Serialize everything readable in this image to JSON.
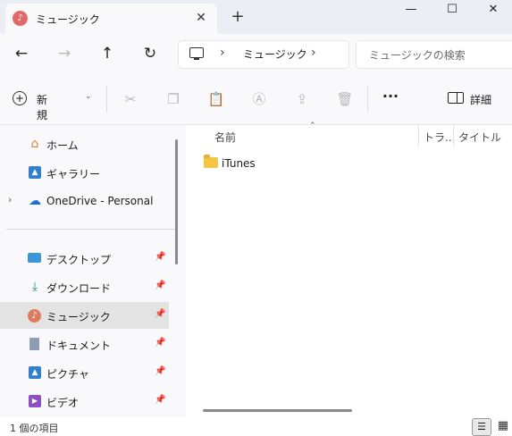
{
  "tab": {
    "title": "ミュージック",
    "icon": "music-note-icon",
    "close": "✕"
  },
  "new_tab": "+",
  "window": {
    "minimize": "—",
    "maximize": "☐",
    "close": "✕"
  },
  "nav": {
    "back": "←",
    "forward": "→",
    "up": "↑",
    "refresh": "↻"
  },
  "address": {
    "separator1": "›",
    "segment": "ミュージック",
    "separator2": "›"
  },
  "search": {
    "placeholder": "ミュージックの検索"
  },
  "toolbar": {
    "new_label": "新規作成",
    "new_caret": "⌄",
    "more": "···",
    "details_label": "詳細"
  },
  "sidebar": {
    "items": [
      {
        "label": "ホーム",
        "icon": "home-icon"
      },
      {
        "label": "ギャラリー",
        "icon": "gallery-icon"
      },
      {
        "label": "OneDrive - Personal",
        "icon": "onedrive-icon"
      },
      {
        "label": "デスクトップ",
        "icon": "desktop-icon",
        "pinned": true
      },
      {
        "label": "ダウンロード",
        "icon": "download-icon",
        "pinned": true
      },
      {
        "label": "ミュージック",
        "icon": "music-icon",
        "pinned": true,
        "selected": true
      },
      {
        "label": "ドキュメント",
        "icon": "documents-icon",
        "pinned": true
      },
      {
        "label": "ピクチャ",
        "icon": "pictures-icon",
        "pinned": true
      },
      {
        "label": "ビデオ",
        "icon": "videos-icon",
        "pinned": true
      }
    ]
  },
  "columns": [
    "名前",
    "トラ...",
    "タイトル"
  ],
  "files": [
    {
      "name": "iTunes",
      "icon": "folder-icon"
    }
  ],
  "status": {
    "count": "1 個の項目"
  },
  "colors": {
    "accent": "#e06a6a",
    "folder": "#f4c542",
    "selected_bg": "#e3e3e3",
    "chrome_bg": "#ebeff5"
  }
}
